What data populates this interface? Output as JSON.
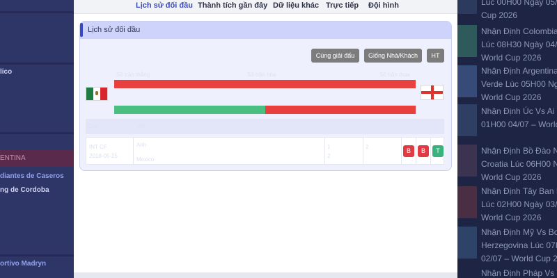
{
  "tabs": [
    "Lịch sử đối đầu",
    "Thành tích gần đây",
    "Dữ liệu khác",
    "Trực tiếp",
    "Đội hình"
  ],
  "panel": {
    "title": "Lịch sử đối đầu"
  },
  "filters": {
    "same_league": "Cùng giải đấu",
    "same_home_away": "Giống Nhà/Khách",
    "ht": "HT"
  },
  "ghost": {
    "league": "Số trận thắng",
    "draw": "Số trận hòa",
    "loss": "Số trận thua",
    "col_league": "Giải",
    "col_team": "Đội",
    "date_tour": "INT CF",
    "date": "2018-05-25",
    "home": "Anh",
    "away": "Mexico",
    "hs": "1",
    "as": "2"
  },
  "stats": {
    "bar1_green_fraction": 0,
    "bar2_green_fraction": 0.5
  },
  "results": [
    "B",
    "B",
    "T"
  ],
  "colors": {
    "accent": "#3a48c2",
    "loss": "#e8403f",
    "win": "#4bbf82"
  },
  "flags": {
    "left": "mexico-flag-icon",
    "right": "england-flag-icon"
  },
  "background": {
    "left": {
      "item1": "lico",
      "section": "ENTINA",
      "item2": "diantes de Caseros",
      "item3": "ng de Cordoba",
      "item4": "ortivo Madryn"
    },
    "right": [
      [
        "Lúc 00H00 Ngày 05/0",
        "Cup 2026"
      ],
      [
        "Nhận Định Colombia V",
        "Lúc 08H30 Ngày 04/0",
        "World Cup 2026"
      ],
      [
        "Nhận Định Argentina",
        "Verde Lúc 05H00 Ngà",
        "World Cup 2026"
      ],
      [
        "Nhận Định Úc Vs Ai C",
        "01H00 04/07 – World"
      ],
      [
        "Nhận Định Bồ Đào Nh",
        "Croatia Lúc 06H00 N",
        "World Cup 2026"
      ],
      [
        "Nhận Định Tây Ban N",
        "Lúc 02H00 Ngày 03/0",
        "World Cup 2026"
      ],
      [
        "Nhận Định Mỹ Vs Bos",
        "Herzegovina Lúc 07H",
        "02/07 – World Cup 20"
      ],
      [
        "Nhận Định Pháp Vs T"
      ]
    ]
  }
}
